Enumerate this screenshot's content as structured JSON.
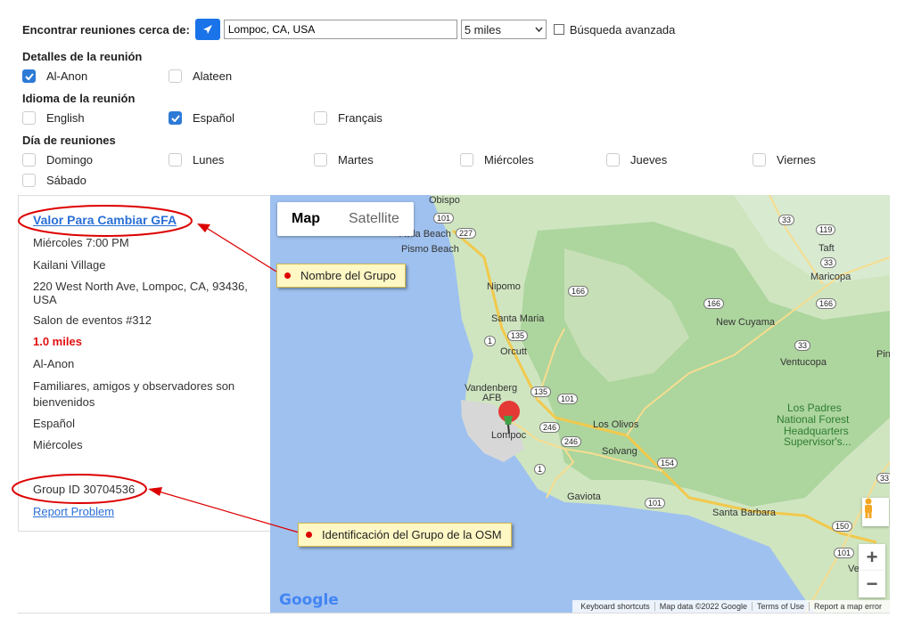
{
  "search": {
    "label": "Encontrar reuniones cerca de:",
    "location_value": "Lompoc, CA, USA",
    "distance_value": "5 miles",
    "advanced_label": "Búsqueda avanzada"
  },
  "details": {
    "title": "Detalles de la reunión",
    "options": [
      {
        "label": "Al-Anon",
        "checked": true
      },
      {
        "label": "Alateen",
        "checked": false
      }
    ]
  },
  "language": {
    "title": "Idioma de la reunión",
    "options": [
      {
        "label": "English",
        "checked": false
      },
      {
        "label": "Español",
        "checked": true
      },
      {
        "label": "Français",
        "checked": false
      }
    ]
  },
  "days": {
    "title": "Día de reuniones",
    "options": [
      {
        "label": "Domingo",
        "checked": false
      },
      {
        "label": "Lunes",
        "checked": false
      },
      {
        "label": "Martes",
        "checked": false
      },
      {
        "label": "Miércoles",
        "checked": false
      },
      {
        "label": "Jueves",
        "checked": false
      },
      {
        "label": "Viernes",
        "checked": false
      },
      {
        "label": "Sábado",
        "checked": false
      }
    ]
  },
  "result": {
    "group_name": "Valor Para Cambiar GFA",
    "day_time": "Miércoles 7:00 PM",
    "venue": "Kailani Village",
    "address": "220 West North Ave, Lompoc, CA, 93436, USA",
    "room": "Salon de eventos #312",
    "distance": "1.0 miles",
    "type": "Al-Anon",
    "audience": "Familiares, amigos y observadores son bienvenidos",
    "language": "Español",
    "day": "Miércoles",
    "group_id": "Group ID 30704536",
    "report": "Report Problem"
  },
  "callouts": {
    "group_name": "Nombre del Grupo",
    "group_id": "Identificación del Grupo de la OSM"
  },
  "map": {
    "toggle_map": "Map",
    "toggle_satellite": "Satellite",
    "google": "Google",
    "footer": [
      "Keyboard shortcuts",
      "Map data ©2022 Google",
      "Terms of Use",
      "Report a map error"
    ],
    "places": [
      {
        "name": "Obispo"
      },
      {
        "name": "Avila Beach"
      },
      {
        "name": "Pismo Beach"
      },
      {
        "name": "Nipomo"
      },
      {
        "name": "Santa Maria"
      },
      {
        "name": "Orcutt"
      },
      {
        "name": "Vandenberg"
      },
      {
        "name": "AFB"
      },
      {
        "name": "Lompoc"
      },
      {
        "name": "Los Olivos"
      },
      {
        "name": "Solvang"
      },
      {
        "name": "Gaviota"
      },
      {
        "name": "Santa Barbara"
      },
      {
        "name": "Taft"
      },
      {
        "name": "Maricopa"
      },
      {
        "name": "New Cuyama"
      },
      {
        "name": "Ventucopa"
      },
      {
        "name": "Los Padres"
      },
      {
        "name": "National Forest"
      },
      {
        "name": "Headquarters"
      },
      {
        "name": "Supervisor's..."
      },
      {
        "name": "Pine"
      },
      {
        "name": "Ve"
      }
    ],
    "shields": [
      "101",
      "227",
      "166",
      "135",
      "1",
      "135",
      "101",
      "246",
      "246",
      "154",
      "1",
      "101",
      "101",
      "33",
      "119",
      "33",
      "166",
      "166",
      "33",
      "150",
      "33"
    ]
  }
}
